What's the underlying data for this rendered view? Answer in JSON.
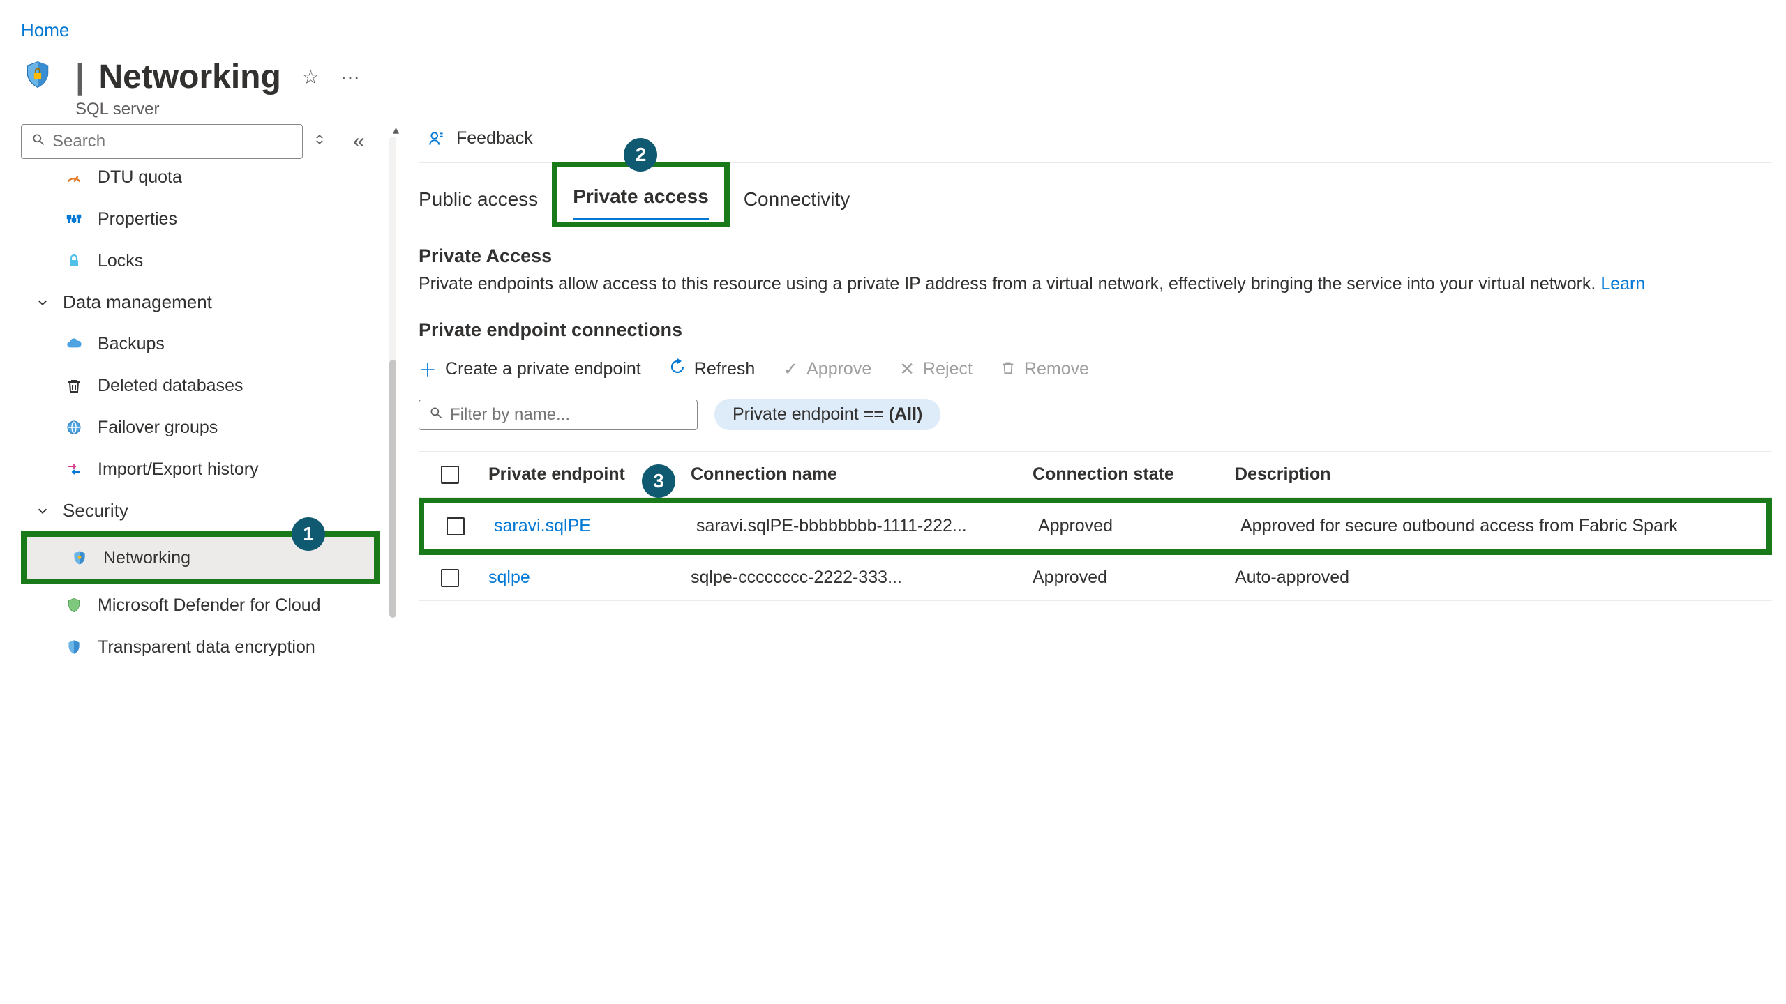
{
  "breadcrumb": {
    "home": "Home"
  },
  "header": {
    "title": "Networking",
    "subtitle": "SQL server"
  },
  "search": {
    "placeholder": "Search"
  },
  "sidebar": {
    "items": [
      {
        "label": "DTU quota"
      },
      {
        "label": "Properties"
      },
      {
        "label": "Locks"
      }
    ],
    "section_dm": "Data management",
    "items_dm": [
      {
        "label": "Backups"
      },
      {
        "label": "Deleted databases"
      },
      {
        "label": "Failover groups"
      },
      {
        "label": "Import/Export history"
      }
    ],
    "section_sec": "Security",
    "items_sec": [
      {
        "label": "Networking"
      },
      {
        "label": "Microsoft Defender for Cloud"
      },
      {
        "label": "Transparent data encryption"
      }
    ]
  },
  "main": {
    "feedback": "Feedback",
    "tabs": {
      "public": "Public access",
      "private": "Private access",
      "connectivity": "Connectivity"
    },
    "section_title": "Private Access",
    "section_desc": "Private endpoints allow access to this resource using a private IP address from a virtual network, effectively bringing the service into your virtual network.",
    "learn_more": "Learn",
    "sub_title": "Private endpoint connections",
    "toolbar": {
      "create": "Create a private endpoint",
      "refresh": "Refresh",
      "approve": "Approve",
      "reject": "Reject",
      "remove": "Remove"
    },
    "filter": {
      "placeholder": "Filter by name...",
      "pill_prefix": "Private endpoint == ",
      "pill_value": "(All)"
    },
    "columns": {
      "endpoint": "Private endpoint",
      "conn_name": "Connection name",
      "conn_state": "Connection state",
      "desc": "Description"
    },
    "rows": [
      {
        "pe": "saravi.sqlPE",
        "conn": "saravi.sqlPE-bbbbbbbb-1111-222...",
        "state": "Approved",
        "desc": "Approved for secure outbound access from Fabric Spark"
      },
      {
        "pe": "sqlpe",
        "conn": "sqlpe-cccccccc-2222-333...",
        "state": "Approved",
        "desc": "Auto-approved"
      }
    ]
  },
  "callouts": {
    "b1": "1",
    "b2": "2",
    "b3": "3"
  }
}
